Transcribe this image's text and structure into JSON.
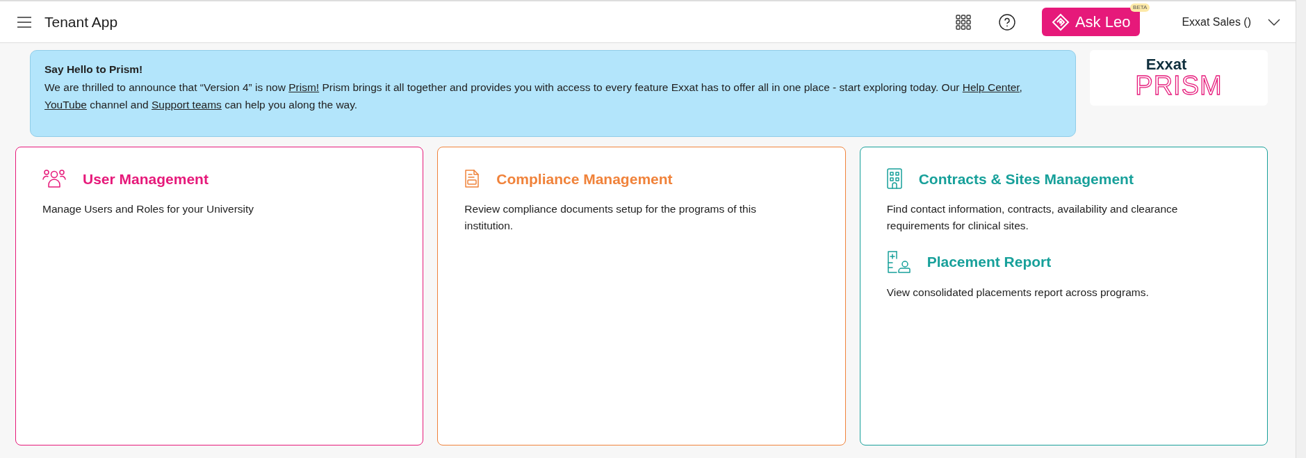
{
  "header": {
    "app_title": "Tenant App",
    "ask_leo": {
      "label": "Ask Leo",
      "badge": "BETA"
    },
    "user": {
      "name": "Exxat Sales ()"
    }
  },
  "banner": {
    "title": "Say Hello to Prism!",
    "segments": [
      {
        "kind": "text",
        "text": "We are thrilled to announce that “Version 4” is now"
      },
      {
        "kind": "link",
        "text": "Prism!"
      },
      {
        "kind": "text",
        "text": "Prism brings it all together and provides you with access to every feature Exxat has to offer all in one place - start exploring today. Our"
      },
      {
        "kind": "link",
        "text": "Help Center,"
      },
      {
        "kind": "link",
        "text": "YouTube"
      },
      {
        "kind": "text",
        "text": "channel and"
      },
      {
        "kind": "link",
        "text": "Support teams"
      },
      {
        "kind": "text",
        "text": "can help you along the way."
      }
    ]
  },
  "logo": {
    "brand": "Exxat",
    "product": "PRISM"
  },
  "cards": [
    {
      "color": "#e6197a",
      "items": [
        {
          "kind": "users",
          "title": "User Management",
          "description": "Manage Users and Roles for your University"
        }
      ]
    },
    {
      "color": "#f0823a",
      "items": [
        {
          "kind": "document",
          "title": "Compliance Management",
          "description": "Review compliance documents setup for the programs of this institution."
        }
      ]
    },
    {
      "color": "#17a09a",
      "items": [
        {
          "kind": "building",
          "title": "Contracts & Sites Management",
          "description": "Find contact information, contracts, availability and clearance requirements for clinical sites."
        },
        {
          "kind": "report",
          "title": "Placement Report",
          "description": "View consolidated placements report across programs."
        }
      ]
    }
  ]
}
